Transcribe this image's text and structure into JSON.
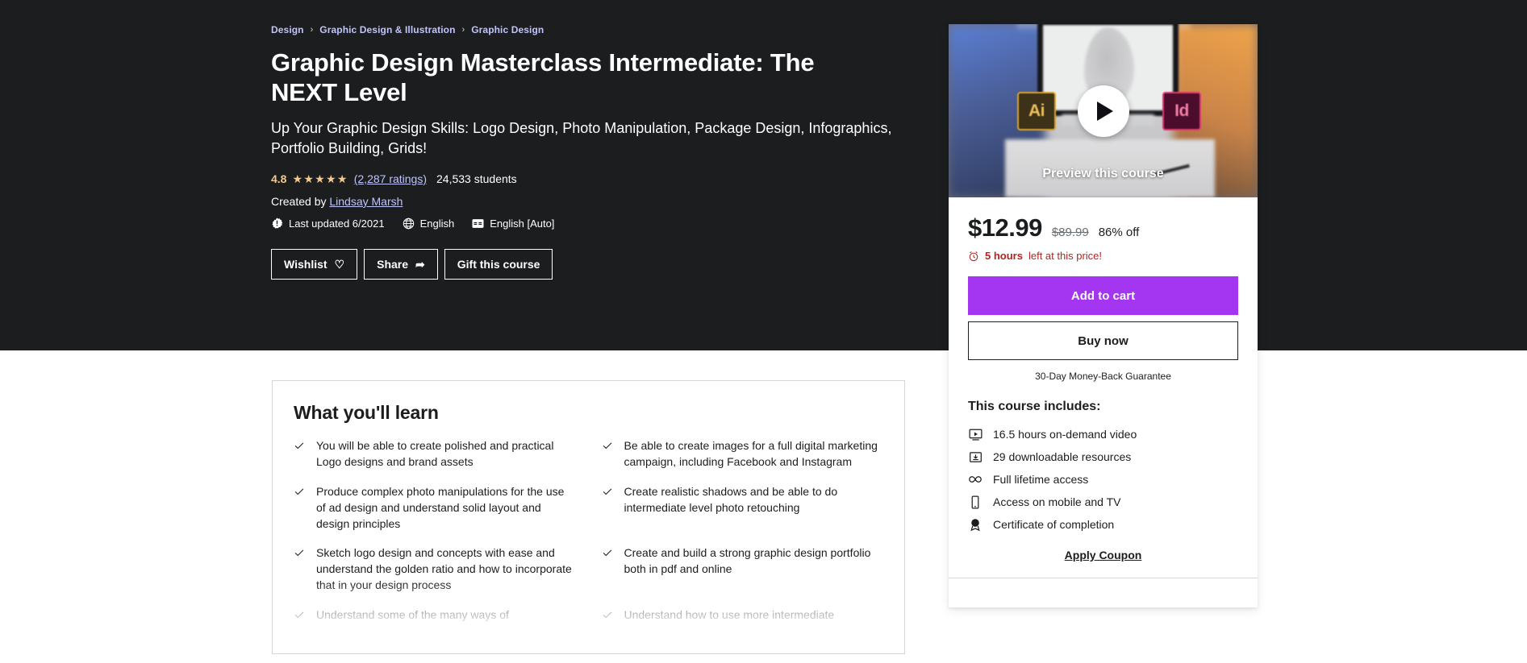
{
  "theme": {
    "hero_bg": "#1c1d1f",
    "accent_purple": "#a435f0",
    "link_purple": "#c0c4fc",
    "star_gold": "#f3ca8c",
    "urgency_red": "#b4231f",
    "border_gray": "#d1d7dc"
  },
  "breadcrumb": [
    {
      "label": "Design"
    },
    {
      "label": "Graphic Design & Illustration"
    },
    {
      "label": "Graphic Design"
    }
  ],
  "breadcrumb_separator": "›",
  "course": {
    "title": "Graphic Design Masterclass Intermediate: The NEXT Level",
    "subtitle": "Up Your Graphic Design Skills: Logo Design, Photo Manipulation, Package Design, Infographics, Portfolio Building, Grids!",
    "rating_value": "4.8",
    "stars": "★★★★★",
    "ratings_link": "(2,287 ratings)",
    "students": "24,533 students",
    "created_by_prefix": "Created by",
    "instructor": "Lindsay Marsh",
    "meta": [
      {
        "icon": "info-badge-icon",
        "label": "Last updated 6/2021"
      },
      {
        "icon": "globe-icon",
        "label": "English"
      },
      {
        "icon": "closed-caption-icon",
        "label": "English [Auto]"
      }
    ]
  },
  "actions": [
    {
      "label": "Wishlist",
      "icon": "heart-icon",
      "glyph": "♡"
    },
    {
      "label": "Share",
      "icon": "share-arrow-icon",
      "glyph": "➦"
    },
    {
      "label": "Gift this course",
      "icon": "none",
      "glyph": ""
    }
  ],
  "preview": {
    "label": "Preview this course",
    "play_icon": "play-icon",
    "badge_ai": "Ai",
    "badge_id": "Id"
  },
  "purchase": {
    "price_current": "$12.99",
    "price_original": "$89.99",
    "discount": "86% off",
    "urgency_bold": "5 hours",
    "urgency_rest": "left at this price!",
    "urgency_icon": "alarm-clock-icon",
    "add_to_cart": "Add to cart",
    "buy_now": "Buy now",
    "guarantee": "30-Day Money-Back Guarantee",
    "includes_title": "This course includes:",
    "includes": [
      {
        "icon": "video-play-icon",
        "label": "16.5 hours on-demand video"
      },
      {
        "icon": "download-box-icon",
        "label": "29 downloadable resources"
      },
      {
        "icon": "infinity-icon",
        "label": "Full lifetime access"
      },
      {
        "icon": "mobile-device-icon",
        "label": "Access on mobile and TV"
      },
      {
        "icon": "award-ribbon-icon",
        "label": "Certificate of completion"
      }
    ],
    "apply_coupon": "Apply Coupon"
  },
  "learn": {
    "title": "What you'll learn",
    "check_glyph": "✓",
    "items": [
      "You will be able to create polished and practical Logo designs and brand assets",
      "Be able to create images for a full digital marketing campaign, including Facebook and Instagram",
      "Produce complex photo manipulations for the use of ad design and understand solid layout and design principles",
      "Create realistic shadows and be able to do intermediate level photo retouching",
      "Sketch logo design and concepts with ease and understand the golden ratio and how to incorporate that in your design process",
      "Create and build a strong graphic design portfolio both in pdf and online",
      "Understand some of the many ways of",
      "Understand how to use more intermediate"
    ]
  }
}
